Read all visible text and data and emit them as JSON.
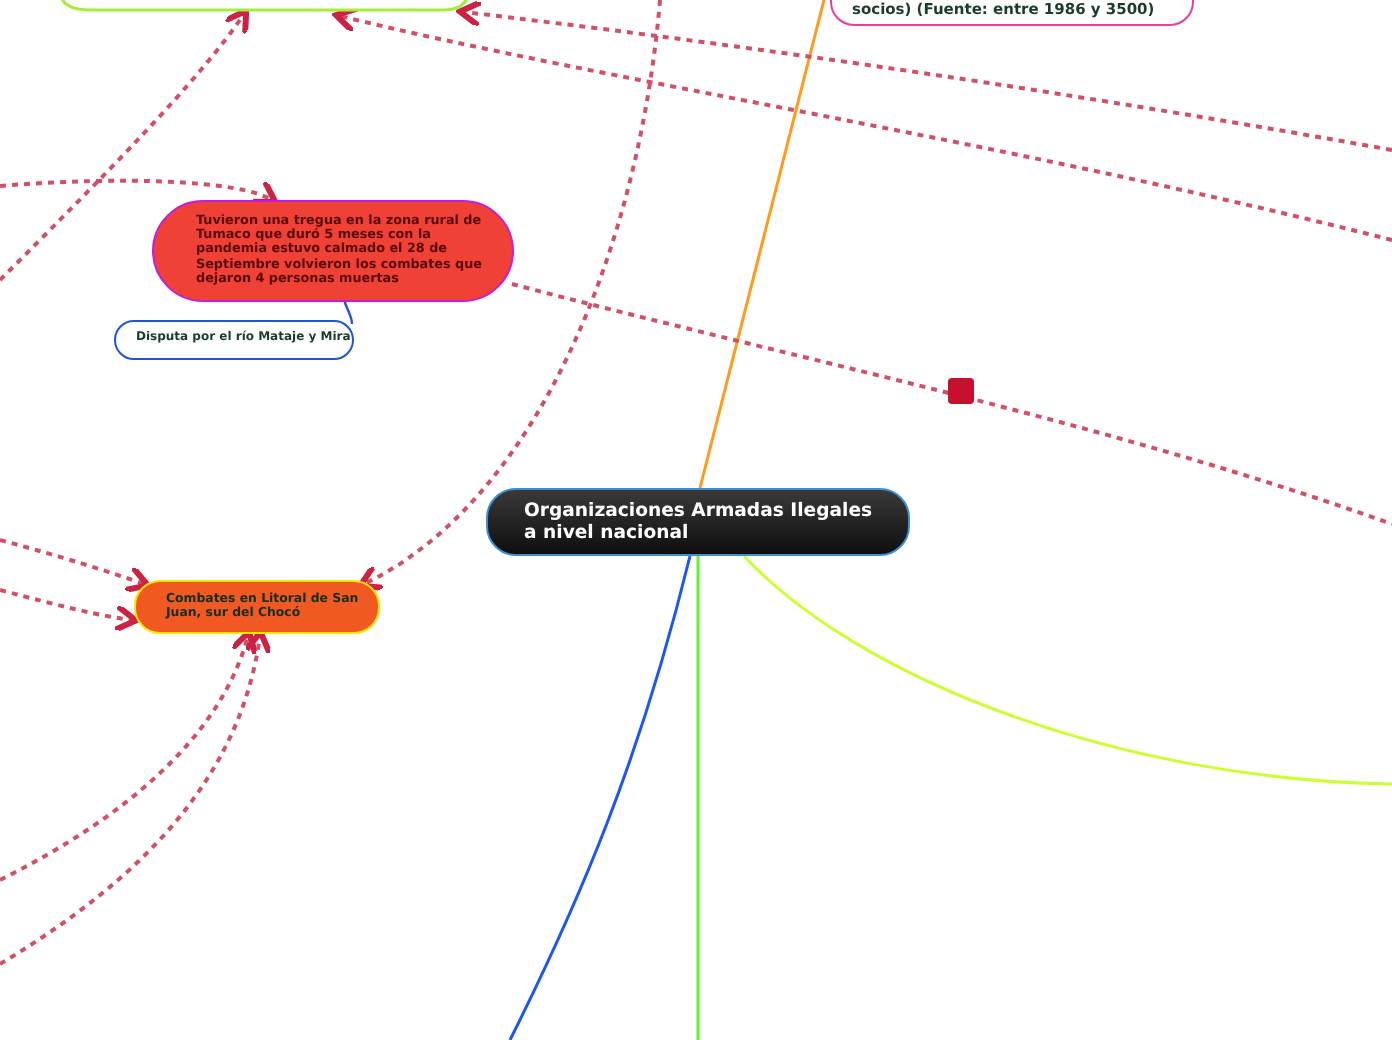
{
  "central": {
    "text": "Organizaciones Armadas Ilegales a nivel nacional"
  },
  "nodes": [
    {
      "text": "socios) (Fuente: entre 1986 y 3500)",
      "color": "#e83ca0"
    },
    {
      "text": "Tuvieron una tregua en la zona rural de Tumaco que duró 5 meses con la pandemia estuvo calmado el 28 de Septiembre volvieron los combates que dejaron 4 personas muertas",
      "color": "#c21ee0"
    },
    {
      "text": "Disputa por el río Mataje y Mira",
      "color": "#1e56d6"
    },
    {
      "text": "Combates en Litoral de San Juan, sur del Chocó",
      "color": "#ffe600"
    }
  ]
}
